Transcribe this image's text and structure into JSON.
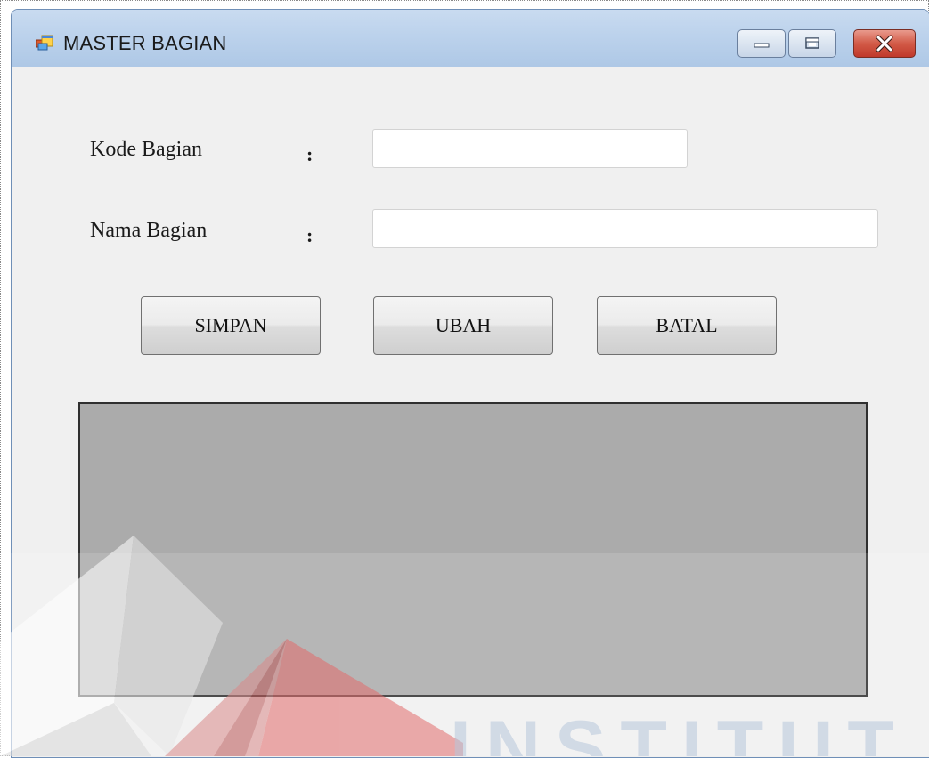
{
  "window": {
    "title": "MASTER BAGIAN",
    "icon": "form-app-icon",
    "controls": {
      "minimize": "minimize-icon",
      "maximize": "maximize-icon",
      "close": "close-icon"
    },
    "colors": {
      "titlebar": "#bcd2ec",
      "close": "#c0392b",
      "client": "#f0f0f0"
    }
  },
  "form": {
    "kode_label": "Kode Bagian",
    "kode_colon": ":",
    "kode_value": "",
    "nama_label": "Nama Bagian",
    "nama_colon": ":",
    "nama_value": ""
  },
  "buttons": {
    "simpan": "SIMPAN",
    "ubah": "UBAH",
    "batal": "BATAL"
  },
  "grid": {
    "background": "#ababab"
  },
  "watermark": {
    "text": "INSTITUT BISNIS",
    "logo": "stikom-logo"
  }
}
